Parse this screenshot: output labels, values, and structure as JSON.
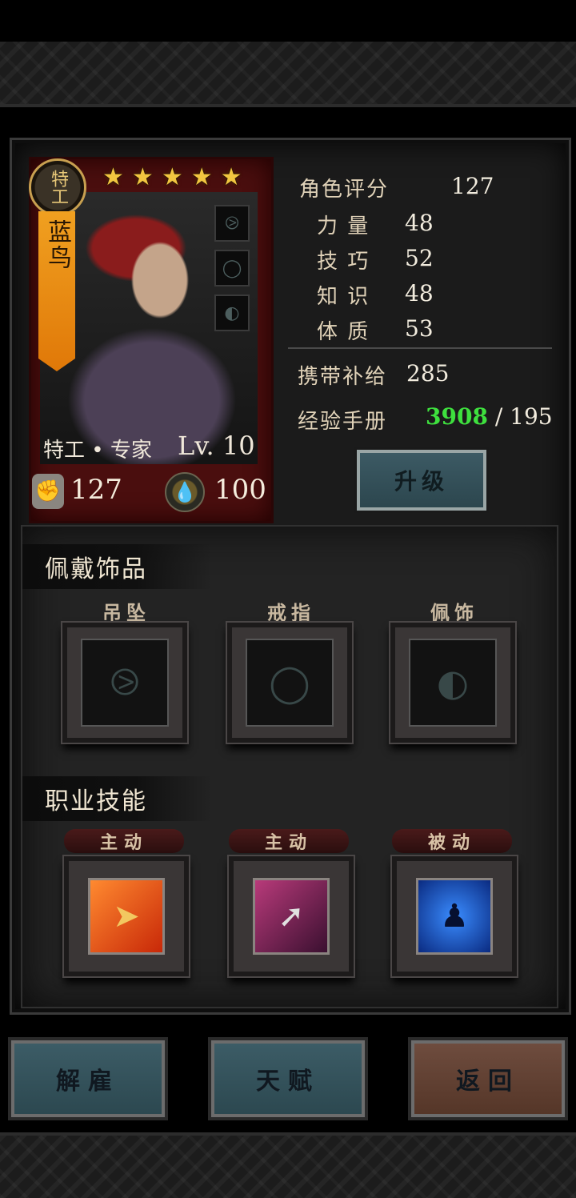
{
  "hero": {
    "class_badge": "特工",
    "name": "蓝鸟",
    "stars": [
      "★",
      "★",
      "★",
      "★",
      "★"
    ],
    "subtitle": "特工 • 专家",
    "level": "Lv. 10",
    "power": "127",
    "supply": "100",
    "mini_slots": [
      "pendant-icon",
      "ring-icon",
      "charm-icon"
    ]
  },
  "stats": {
    "rating_label": "角色评分",
    "rating_value": "127",
    "attributes": [
      {
        "label": "力 量",
        "value": "48"
      },
      {
        "label": "技 巧",
        "value": "52"
      },
      {
        "label": "知 识",
        "value": "48"
      },
      {
        "label": "体 质",
        "value": "53"
      }
    ],
    "carry_label": "携带补给",
    "carry_value": "285",
    "exp_label": "经验手册",
    "exp_current": "3908",
    "exp_sep": " / ",
    "exp_required": "195",
    "upgrade_label": "升级"
  },
  "accessories": {
    "title": "佩戴饰品",
    "slots": [
      {
        "label": "吊坠",
        "icon": "pendant-icon"
      },
      {
        "label": "戒指",
        "icon": "ring-icon"
      },
      {
        "label": "佩饰",
        "icon": "charm-icon"
      }
    ]
  },
  "skills": {
    "title": "职业技能",
    "items": [
      {
        "tag": "主动",
        "icon": "bullet-icon",
        "color": "#e84a18"
      },
      {
        "tag": "主动",
        "icon": "spear-icon",
        "color": "#7a2a5a"
      },
      {
        "tag": "被动",
        "icon": "silhouette-icon",
        "color": "#1a64d8"
      }
    ]
  },
  "buttons": {
    "dismiss": "解雇",
    "talent": "天赋",
    "back": "返回"
  },
  "colors": {
    "exp_highlight": "#3ee03e",
    "star": "#f2c640",
    "ribbon": "#f09018"
  }
}
